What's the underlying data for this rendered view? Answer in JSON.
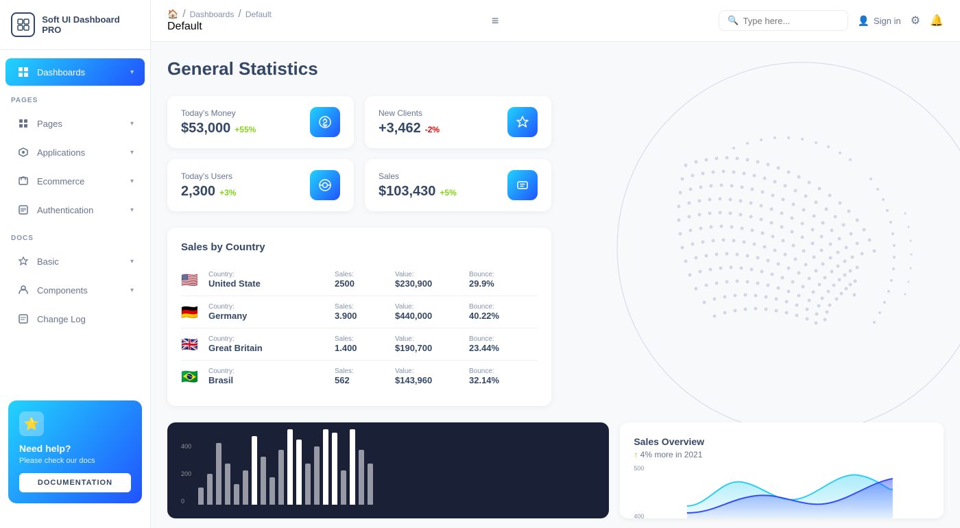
{
  "sidebar": {
    "logo_icon": "⊞",
    "logo_text": "Soft UI Dashboard PRO",
    "sections": [
      {
        "items": [
          {
            "id": "dashboards",
            "label": "Dashboards",
            "icon": "⊡",
            "active": true,
            "has_arrow": true
          }
        ]
      },
      {
        "label": "PAGES",
        "items": [
          {
            "id": "pages",
            "label": "Pages",
            "icon": "📊",
            "active": false,
            "has_arrow": true
          },
          {
            "id": "applications",
            "label": "Applications",
            "icon": "🔧",
            "active": false,
            "has_arrow": true
          },
          {
            "id": "ecommerce",
            "label": "Ecommerce",
            "icon": "🛒",
            "active": false,
            "has_arrow": true
          },
          {
            "id": "authentication",
            "label": "Authentication",
            "icon": "📄",
            "active": false,
            "has_arrow": true
          }
        ]
      },
      {
        "label": "DOCS",
        "items": [
          {
            "id": "basic",
            "label": "Basic",
            "icon": "🚀",
            "active": false,
            "has_arrow": true
          },
          {
            "id": "components",
            "label": "Components",
            "icon": "👤",
            "active": false,
            "has_arrow": true
          },
          {
            "id": "changelog",
            "label": "Change Log",
            "icon": "📋",
            "active": false,
            "has_arrow": false
          }
        ]
      }
    ],
    "help_card": {
      "title": "Need help?",
      "subtitle": "Please check our docs",
      "button_label": "DOCUMENTATION"
    }
  },
  "topbar": {
    "breadcrumb": {
      "home_icon": "🏠",
      "items": [
        "Dashboards",
        "Default"
      ]
    },
    "page_title": "Default",
    "hamburger": "≡",
    "search_placeholder": "Type here...",
    "sign_in_label": "Sign in",
    "settings_icon": "⚙",
    "notifications_icon": "🔔"
  },
  "page": {
    "title": "General Statistics"
  },
  "stats": [
    {
      "label": "Today's Money",
      "value": "$53,000",
      "change": "+55%",
      "change_type": "positive",
      "icon": "💵"
    },
    {
      "label": "New Clients",
      "value": "+3,462",
      "change": "-2%",
      "change_type": "negative",
      "icon": "🏆"
    },
    {
      "label": "Today's Users",
      "value": "2,300",
      "change": "+3%",
      "change_type": "positive",
      "icon": "🌐"
    },
    {
      "label": "Sales",
      "value": "$103,430",
      "change": "+5%",
      "change_type": "positive",
      "icon": "🛒"
    }
  ],
  "sales_by_country": {
    "title": "Sales by Country",
    "columns": [
      "Country:",
      "Sales:",
      "Value:",
      "Bounce:"
    ],
    "rows": [
      {
        "flag": "🇺🇸",
        "country": "United State",
        "sales": "2500",
        "value": "$230,900",
        "bounce": "29.9%"
      },
      {
        "flag": "🇩🇪",
        "country": "Germany",
        "sales": "3.900",
        "value": "$440,000",
        "bounce": "40.22%"
      },
      {
        "flag": "🇬🇧",
        "country": "Great Britain",
        "sales": "1.400",
        "value": "$190,700",
        "bounce": "23.44%"
      },
      {
        "flag": "🇧🇷",
        "country": "Brasil",
        "sales": "562",
        "value": "$143,960",
        "bounce": "32.14%"
      }
    ]
  },
  "charts": {
    "bar_chart": {
      "y_labels": [
        "400",
        "200",
        "0"
      ],
      "bars": [
        10,
        20,
        45,
        30,
        15,
        25,
        60,
        35,
        20,
        40,
        70,
        50,
        30,
        45,
        80,
        55,
        25,
        65,
        40,
        30
      ]
    },
    "sales_overview": {
      "title": "Sales Overview",
      "subtitle": "4% more in 2021",
      "y_labels": [
        "500",
        "400"
      ]
    }
  }
}
